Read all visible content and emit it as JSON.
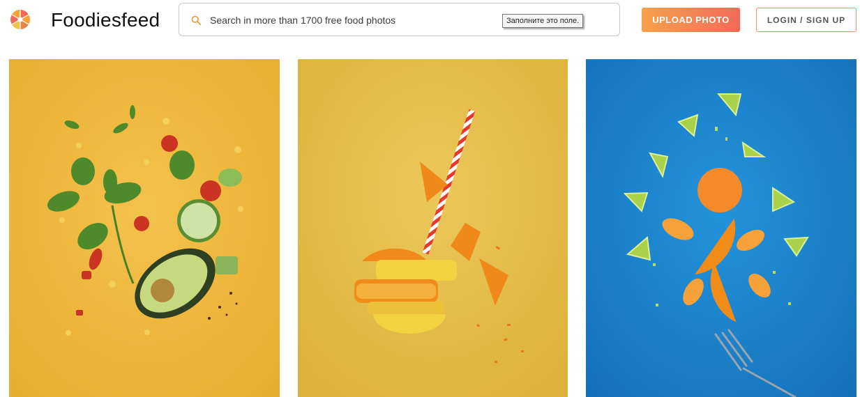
{
  "brand": {
    "name": "Foodiesfeed",
    "logo_icon": "citrus-logo-icon",
    "logo_colors": [
      "#f6a13a",
      "#ef6a56",
      "#f3c24c",
      "#e8844a"
    ]
  },
  "search": {
    "placeholder": "Search in more than 1700 free food photos",
    "value": "",
    "icon": "search-icon",
    "icon_color": "#e09a3c",
    "validation_tooltip": "Заполните это поле."
  },
  "actions": {
    "upload_label": "UPLOAD PHOTO",
    "login_label": "LOGIN / SIGN UP",
    "upload_gradient": [
      "#f7a14a",
      "#f16a5a"
    ],
    "login_border": "#f08a6f"
  },
  "gallery": {
    "photos": [
      {
        "subject": "flying-salad-ingredients-photo",
        "background": "#f0c04a"
      },
      {
        "subject": "flying-orange-slices-with-straw-photo",
        "background": "#ebc350"
      },
      {
        "subject": "flying-mandarin-and-lime-photo",
        "background": "#1f87d2"
      }
    ]
  }
}
